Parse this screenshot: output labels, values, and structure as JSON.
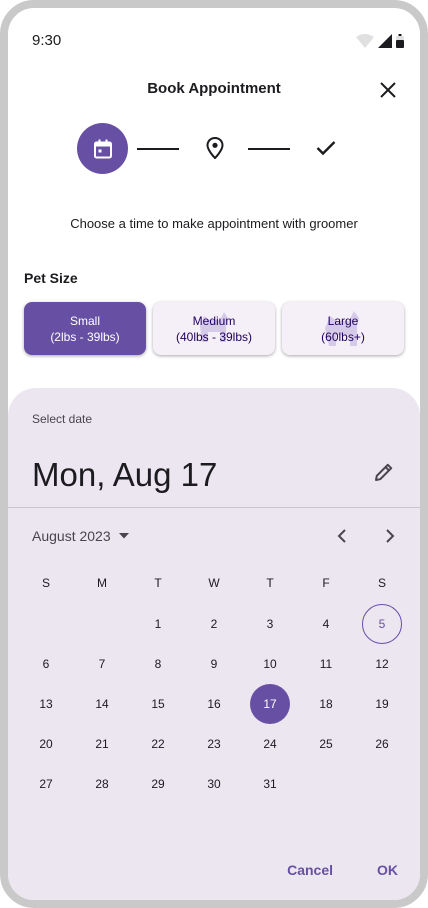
{
  "status_bar": {
    "time": "9:30"
  },
  "header": {
    "title": "Book Appointment"
  },
  "stepper": {
    "steps": [
      "calendar-icon",
      "location-pin-icon",
      "check-icon"
    ],
    "active_index": 0
  },
  "subtitle": "Choose a time to make appointment with groomer",
  "pet_size": {
    "label": "Pet Size",
    "options": [
      {
        "name": "Small",
        "range": "(2lbs - 39lbs)",
        "selected": true
      },
      {
        "name": "Medium",
        "range": "(40lbs - 39lbs)",
        "selected": false
      },
      {
        "name": "Large",
        "range": "(60lbs+)",
        "selected": false
      }
    ]
  },
  "date_picker": {
    "label": "Select date",
    "headline": "Mon, Aug 17",
    "month_year": "August 2023",
    "weekdays": [
      "S",
      "M",
      "T",
      "W",
      "T",
      "F",
      "S"
    ],
    "leading_blanks": 2,
    "days_in_month": 31,
    "today": 5,
    "selected": 17,
    "cancel_label": "Cancel",
    "ok_label": "OK"
  },
  "colors": {
    "primary": "#6750a4",
    "surface_container": "#ece6f0",
    "on_surface": "#1c1b1f"
  }
}
